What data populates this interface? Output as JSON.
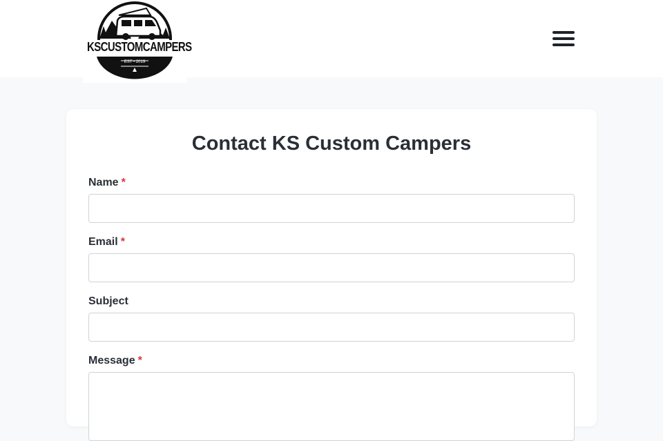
{
  "header": {
    "logo": {
      "brand_text": "KSCUSTOMCAMPERS",
      "est_text": "EST • 2019"
    },
    "menu_icon": "hamburger-menu-icon"
  },
  "form": {
    "title": "Contact KS Custom Campers",
    "required_marker": "*",
    "fields": [
      {
        "label": "Name",
        "required": true,
        "value": "",
        "placeholder": ""
      },
      {
        "label": "Email",
        "required": true,
        "value": "",
        "placeholder": ""
      },
      {
        "label": "Subject",
        "required": false,
        "value": "",
        "placeholder": ""
      },
      {
        "label": "Message",
        "required": true,
        "value": "",
        "placeholder": ""
      }
    ]
  },
  "colors": {
    "accent_required": "#d9363e",
    "text": "#2a2f36",
    "page_background": "#f8f9fb"
  }
}
